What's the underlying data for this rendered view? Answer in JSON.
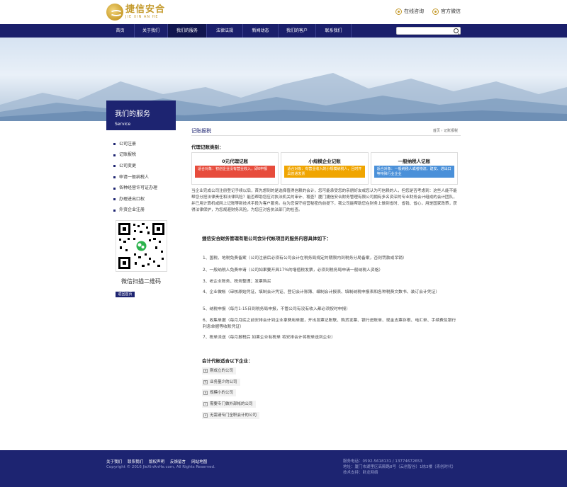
{
  "header": {
    "logo_cn": "捷信安合",
    "logo_en": "JIE XIN AN HE",
    "links": [
      {
        "label": "在线咨询",
        "icon": "headset-icon"
      },
      {
        "label": "官方微信",
        "icon": "wechat-icon"
      }
    ]
  },
  "nav": {
    "items": [
      "首页",
      "关于我们",
      "我们的服务",
      "法律法规",
      "新闻动态",
      "我们的客户",
      "联系我们"
    ],
    "active_index": 2,
    "search_placeholder": ""
  },
  "sidebar": {
    "title_cn": "我们的服务",
    "title_en": "Service",
    "items": [
      "公司注册",
      "记账报税",
      "公司变更",
      "申请一般纳税人",
      "各种经营许可证办理",
      "办理进出口权",
      "外资企业注册"
    ],
    "qr_caption": "微信扫描二维码",
    "back_button": "返回首页"
  },
  "content": {
    "title": "记账报税",
    "breadcrumb": "首页 › 记账报税",
    "category_label": "代理记账类别：",
    "plans": [
      {
        "name": "0元代理记账",
        "desc": "适合对象：初创企业没有营业收入，即0申报",
        "color": "#e74c3c"
      },
      {
        "name": "小规模企业记账",
        "desc": "适合对象：有营业收入的小规模纳税人，且时开具普通发票",
        "color": "#f0a500"
      },
      {
        "name": "一般纳税人记账",
        "desc": "适合对象：一般纳税人或者物流、建安、进出口等特殊行业企业",
        "color": "#4a90d9"
      }
    ],
    "intro": "当企业完成公司注册登记手续以后，首先想到的是选择值得信赖的会计，您可能承受您的亲朋好友或您认为可信赖的人，但您是否考虑到：这些人能不能帮您分担法律责任和法律风险？能否帮助您应对执法机关的审计、稽查？厦门捷信安合财务管理有限公司拥有多名资深的专业财务会计组成的会计团队，并已用计算机或网上记账等新技术手段为客户服务。在为您保守经营秘密的前提下，我公司能帮助您在财务上做到省时、省钱、省心，用是国家政策，获得法律保护，为您规避财务风险，为您应对各执法部门的检查。",
    "services_heading": "捷信安合财务管理有限公司会计代帐项目的服务内容具体如下：",
    "services": [
      "1、国税、地税免费备案（公司注册后必须有公司会计在税务局规定的期限内到税务分局备案，否则罚款或吊销）",
      "2、一般纳税人免费申请（公司如果要开具17%的增值税发票，必须到税务局申请一般纳税人资格）",
      "3、老企业账务、税务整理；发票购买",
      "4、企业做帐（审核原始凭证、填制会计凭证、登记会计账簿、编制会计报表、填制纳税申报表和各种税费文数书、装订会计凭证）",
      "5、纳税申报（每月1-15日到税务局申报，不管公司有没有收入都必须按时申报）",
      "6、收集单据（每月月底之前安排会计到企业拿费用单据，开出发票记账联、购货发票、银行进账单、现金支票存根、电汇单、手续费及银行利息单据等收账凭证）",
      "7、税单派送（每月报税后 如果企业有税单 将安排会计将税单送到企业）"
    ],
    "fit_heading": "会计代帐适合以下企业：",
    "fit_items": [
      {
        "label": "刚成立的公司",
        "icon": "close-box-icon"
      },
      {
        "label": "业务量少的公司",
        "icon": "pen-icon"
      },
      {
        "label": "规模小的公司",
        "icon": "close-box-icon"
      },
      {
        "label": "需要专门做外部帐的公司",
        "icon": "check-box-icon"
      },
      {
        "label": "无需请专门全职会计的公司",
        "icon": "close-box-icon"
      }
    ]
  },
  "footer": {
    "links": [
      "关于我们",
      "联系我们",
      "版权声明",
      "反馈留言",
      "网站地图"
    ],
    "copyright": "Copyright © 2016 JieXinAnHe.com, All Rights Reserved.",
    "phone": "服务电话：0592-5618131 / 13774672653",
    "address": "地址：厦门市湖里区高殿路8号（云创智谷）1栋3楼（青创时代）",
    "support": "技术支持：卧龙网络"
  }
}
